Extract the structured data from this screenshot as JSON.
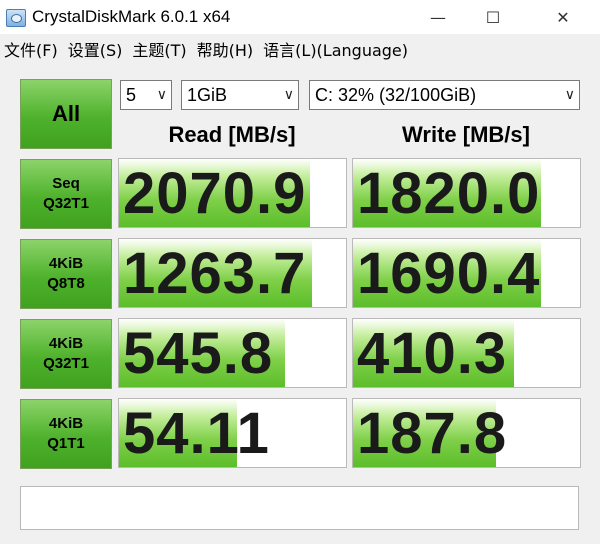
{
  "window": {
    "title": "CrystalDiskMark 6.0.1 x64",
    "minimize_glyph": "—",
    "maximize_glyph": "☐",
    "close_glyph": "✕"
  },
  "menu": [
    {
      "label": "文件(F)"
    },
    {
      "label": "设置(S)"
    },
    {
      "label": "主题(T)"
    },
    {
      "label": "帮助(H)"
    },
    {
      "label": "语言(L)(Language)"
    }
  ],
  "controls": {
    "all_label": "All",
    "count": "5",
    "size": "1GiB",
    "drive": "C: 32% (32/100GiB)",
    "chevron": "∨"
  },
  "columns": {
    "read": "Read [MB/s]",
    "write": "Write [MB/s]"
  },
  "rows": [
    {
      "line1": "Seq",
      "line2": "Q32T1",
      "read": "2070.9",
      "write": "1820.0",
      "read_fill": 0.84,
      "write_fill": 0.83
    },
    {
      "line1": "4KiB",
      "line2": "Q8T8",
      "read": "1263.7",
      "write": "1690.4",
      "read_fill": 0.85,
      "write_fill": 0.83
    },
    {
      "line1": "4KiB",
      "line2": "Q32T1",
      "read": "545.8",
      "write": "410.3",
      "read_fill": 0.73,
      "write_fill": 0.71
    },
    {
      "line1": "4KiB",
      "line2": "Q1T1",
      "read": "54.11",
      "write": "187.8",
      "read_fill": 0.52,
      "write_fill": 0.63
    }
  ],
  "comment": "",
  "colors": {
    "accent_green": "#4fb22c",
    "fill_green": "#7fd048"
  }
}
